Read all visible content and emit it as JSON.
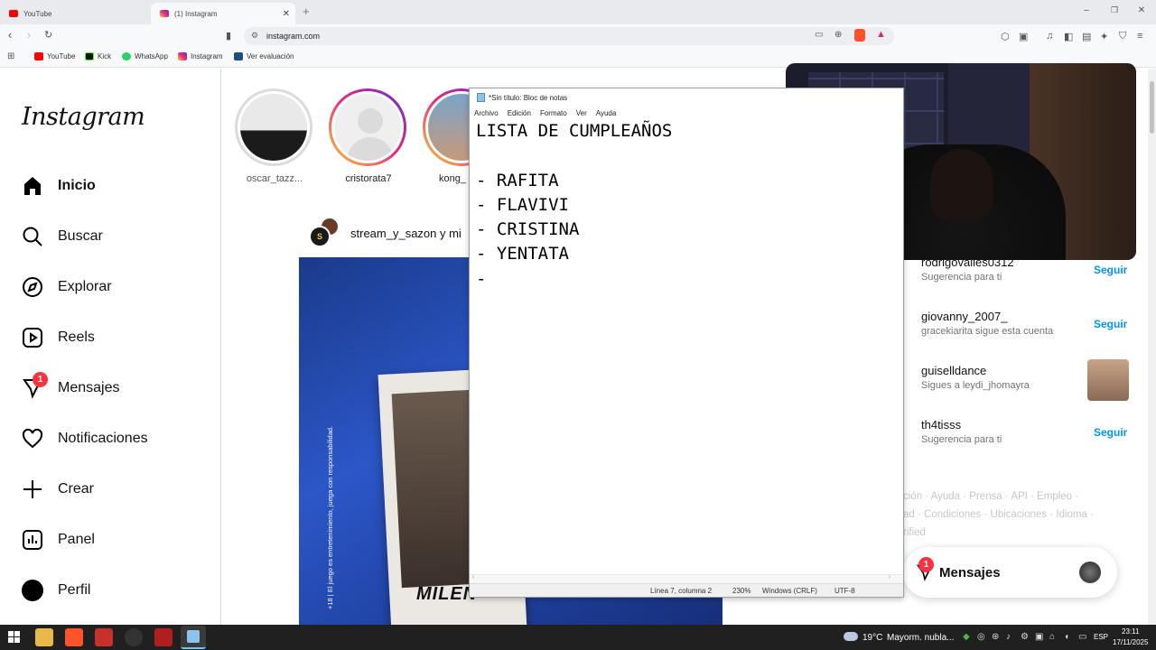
{
  "browser": {
    "tabs": [
      {
        "title": "YouTube",
        "active": false
      },
      {
        "title": "(1) Instagram",
        "active": true
      }
    ],
    "new_tab": "+",
    "url": "instagram.com",
    "bookmarks": [
      "YouTube",
      "Kick",
      "WhatsApp",
      "Instagram",
      "Ver evaluación"
    ]
  },
  "instagram": {
    "logo": "Instagram",
    "nav": [
      {
        "label": "Inicio",
        "icon": "home-icon"
      },
      {
        "label": "Buscar",
        "icon": "search-icon"
      },
      {
        "label": "Explorar",
        "icon": "compass-icon"
      },
      {
        "label": "Reels",
        "icon": "reels-icon"
      },
      {
        "label": "Mensajes",
        "icon": "messenger-icon",
        "badge": "1"
      },
      {
        "label": "Notificaciones",
        "icon": "heart-icon"
      },
      {
        "label": "Crear",
        "icon": "plus-icon"
      },
      {
        "label": "Panel",
        "icon": "dashboard-icon"
      },
      {
        "label": "Perfil",
        "icon": "profile-icon"
      }
    ],
    "stories": [
      "oscar_tazz...",
      "cristorata7",
      "kong_"
    ],
    "post": {
      "author_line": "stream_y_sazon y mi",
      "side_text": "+18 | El juego es entretenimiento, juega con responsabilidad.",
      "bottom_text": "MILEN"
    },
    "suggestions": [
      {
        "user": "rodrigovalles0312",
        "sub": "Sugerencia para ti",
        "action": "Seguir"
      },
      {
        "user": "giovanny_2007_",
        "sub": "gracekiarita sigue esta cuenta",
        "action": "Seguir"
      },
      {
        "user": "guiselldance",
        "sub": "Sigues a leydi_jhomayra",
        "action": ""
      },
      {
        "user": "th4tisss",
        "sub": "Sugerencia para ti",
        "action": "Seguir"
      }
    ],
    "footer_lines": [
      "ción · Ayuda · Prensa · API · Empleo ·",
      "ad · Condiciones · Ubicaciones · Idioma ·",
      "rified"
    ],
    "messages_pill": {
      "label": "Mensajes",
      "badge": "1"
    }
  },
  "notepad": {
    "title": "*Sin título: Bloc de notas",
    "menu": [
      "Archivo",
      "Edición",
      "Formato",
      "Ver",
      "Ayuda"
    ],
    "content": "LISTA DE CUMPLEAÑOS\n\n- RAFITA\n- FLAVIVI\n- CRISTINA\n- YENTATA\n- ",
    "status": {
      "position": "Línea 7, columna 2",
      "zoom": "230%",
      "line_ending": "Windows (CRLF)",
      "encoding": "UTF-8"
    }
  },
  "taskbar": {
    "weather": "19°C",
    "weather_desc": "Mayorm. nubla...",
    "lang": "ESP",
    "time": "23:11",
    "date": "17/11/2025"
  },
  "colors": {
    "instagram_blue": "#0095f6",
    "badge_red": "#ff3040",
    "post_blue": "#2c57c8"
  }
}
